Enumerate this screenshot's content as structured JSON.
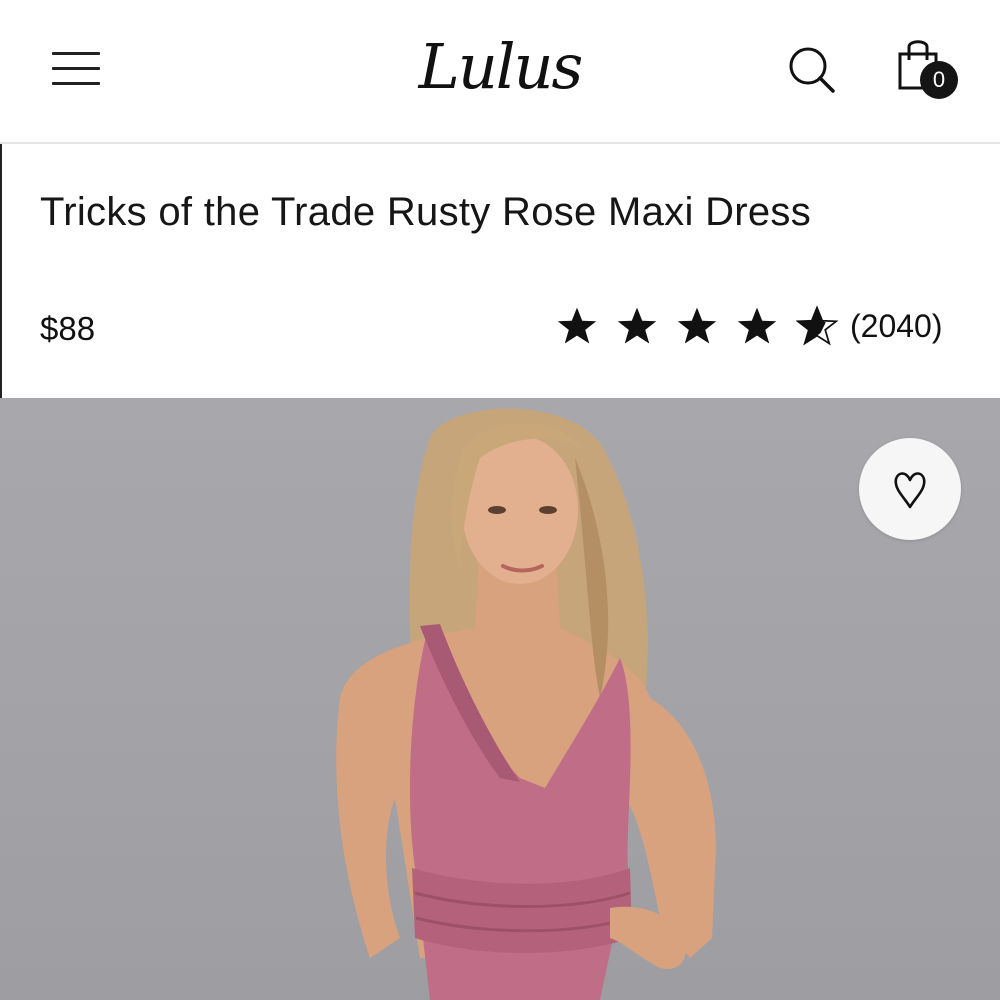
{
  "header": {
    "logo_text": "Lulus",
    "menu_icon": "hamburger-menu-icon",
    "search_icon": "search-icon",
    "bag_icon": "shopping-bag-icon",
    "bag_count": "0"
  },
  "product": {
    "title": "Tricks of the Trade Rusty Rose Maxi Dress",
    "price": "$88",
    "rating": {
      "value": 4.5,
      "max": 5,
      "review_count": "(2040)"
    },
    "wishlist_icon": "heart-icon",
    "image_alt_color": "#c06e88"
  },
  "colors": {
    "text": "#111111",
    "divider": "#e6e6e6",
    "image_background": "#a6a6aa",
    "dress": "#c06e88"
  }
}
